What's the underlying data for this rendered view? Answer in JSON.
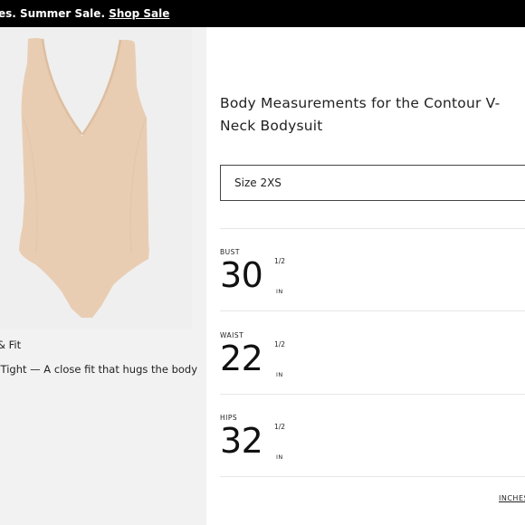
{
  "promo": {
    "text": "es. Summer Sale. ",
    "link": "Shop Sale"
  },
  "fit": {
    "title": "& Fit",
    "description": ": Tight — A close fit that hugs the body"
  },
  "sizing": {
    "title": "Body Measurements for the Contour V-Neck Bodysuit",
    "selected_size": "Size 2XS",
    "measurements": [
      {
        "label": "BUST",
        "value": "30",
        "fraction": "1/2",
        "unit": "IN"
      },
      {
        "label": "WAIST",
        "value": "22",
        "fraction": "1/2",
        "unit": "IN"
      },
      {
        "label": "HIPS",
        "value": "32",
        "fraction": "1/2",
        "unit": "IN"
      }
    ],
    "units_link": "INCHES"
  },
  "colors": {
    "promo_bg": "#000000",
    "panel_bg": "#f2f2f2",
    "garment": "#e9cdb3"
  }
}
